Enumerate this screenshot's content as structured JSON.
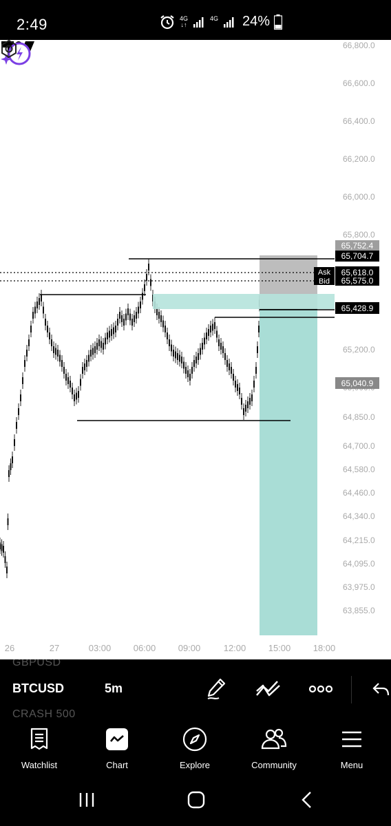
{
  "status": {
    "time": "2:49",
    "net1": "4G",
    "net2": "4G",
    "battery": "24%"
  },
  "chart": {
    "symbol": "BTCUSD",
    "interval": "5m",
    "price_axis": [
      "66,800.0",
      "66,600.0",
      "66,400.0",
      "66,200.0",
      "66,000.0",
      "65,800.0",
      "65,200.0",
      "65,000.0",
      "64,850.0",
      "64,700.0",
      "64,580.0",
      "64,460.0",
      "64,340.0",
      "64,215.0",
      "64,095.0",
      "63,975.0",
      "63,855.0"
    ],
    "price_tags": {
      "upper_box": "65,752.4",
      "upper_line": "65,704.7",
      "ask_value": "65,618.0",
      "bid_value": "65,575.0",
      "mid_level": "65,428.9",
      "stop_level": "65,040.9"
    },
    "ask_label": "Ask",
    "bid_label": "Bid",
    "time_axis": [
      "26",
      "27",
      "03:00",
      "06:00",
      "09:00",
      "12:00",
      "15:00",
      "18:00"
    ]
  },
  "symbol_bar": {
    "prev_symbol": "GBPUSD",
    "next_symbol": "CRASH 500"
  },
  "nav": {
    "watchlist": "Watchlist",
    "chart": "Chart",
    "explore": "Explore",
    "community": "Community",
    "menu": "Menu"
  }
}
